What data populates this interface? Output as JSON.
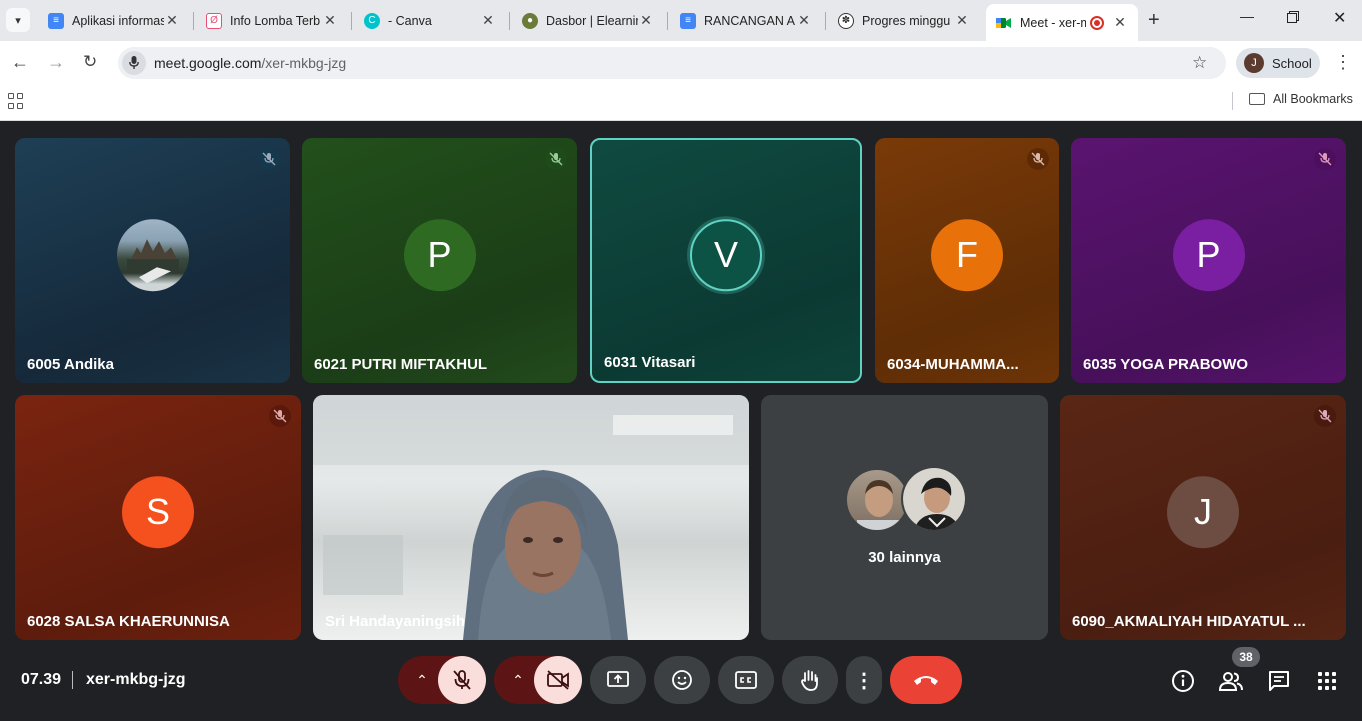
{
  "browser": {
    "tabs": [
      {
        "title": "Aplikasi informas",
        "icon": "google-docs-icon",
        "color": "#4285f4"
      },
      {
        "title": "Info Lomba Terb",
        "icon": "site-icon",
        "color": "#e94e77"
      },
      {
        "title": "- Canva",
        "icon": "canva-icon",
        "color": "#00c4cc"
      },
      {
        "title": "Dasbor | Elearnir",
        "icon": "elearning-icon",
        "color": "#6b7b3a"
      },
      {
        "title": "RANCANGAN AI",
        "icon": "google-docs-icon",
        "color": "#4285f4"
      },
      {
        "title": "Progres minggu",
        "icon": "openai-icon",
        "color": "#333333"
      },
      {
        "title": "Meet - xer-m",
        "icon": "google-meet-icon",
        "color": "#00832d",
        "active": true
      }
    ],
    "url_host": "meet.google.com",
    "url_path": "/xer-mkbg-jzg",
    "profile_initial": "J",
    "profile_name": "School",
    "all_bookmarks": "All Bookmarks"
  },
  "meet": {
    "time": "07.39",
    "meeting_code": "xer-mkbg-jzg",
    "participant_count": "38",
    "tiles": [
      {
        "name": "6005 Andika",
        "avatar": "photo",
        "muted": true
      },
      {
        "name": "6021 PUTRI MIFTAKHUL",
        "initial": "P",
        "muted": true
      },
      {
        "name": "6031 Vitasari",
        "initial": "V",
        "muted": false,
        "speaking": true
      },
      {
        "name": "6034-MUHAMMA...",
        "initial": "F",
        "muted": true
      },
      {
        "name": "6035 YOGA PRABOWO",
        "initial": "P",
        "muted": true
      },
      {
        "name": "6028 SALSA KHAERUNNISA",
        "initial": "S",
        "muted": true
      },
      {
        "name": "Sri Handayaningsih",
        "avatar": "video",
        "muted": false
      },
      {
        "name": "30 lainnya",
        "avatar": "group",
        "muted": false
      },
      {
        "name": "6090_AKMALIYAH HIDAYATUL ...",
        "initial": "J",
        "muted": true
      }
    ],
    "colors": {
      "accent_end_call": "#ea4335",
      "speaking_ring": "#5fd3c3",
      "mic_off_bg": "#f9dedc"
    }
  }
}
